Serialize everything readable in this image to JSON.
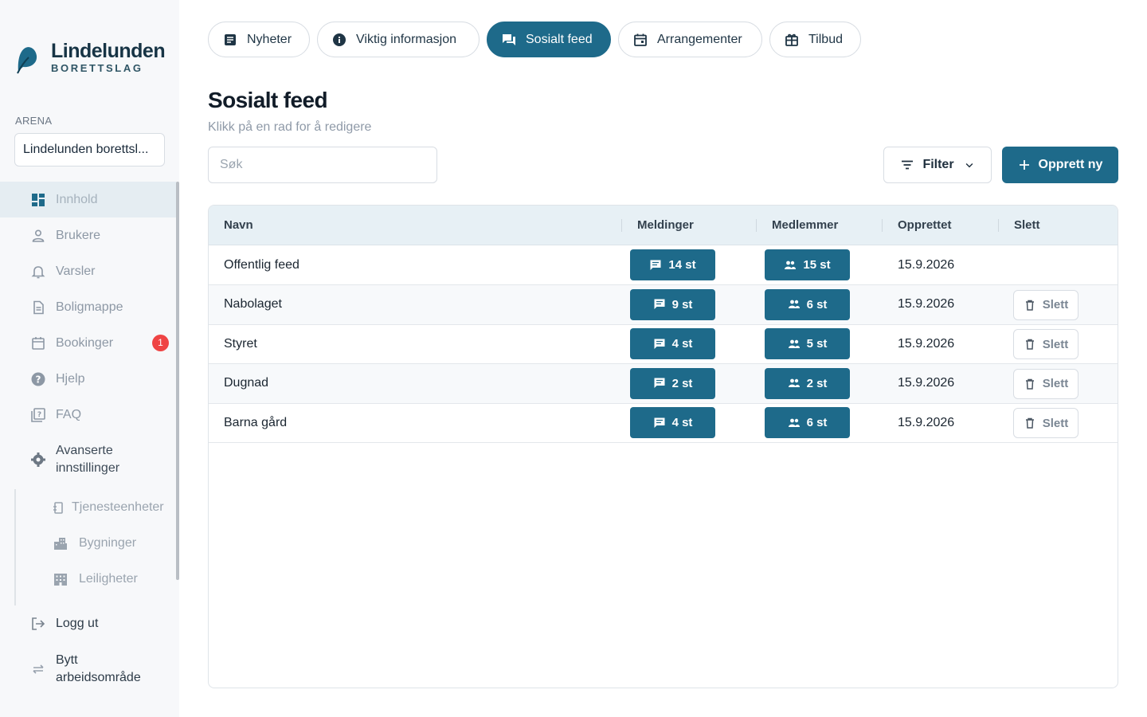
{
  "brand": {
    "name": "Lindelunden",
    "subtitle": "BORETTSLAG",
    "color": "#1e6a8a"
  },
  "sidebar": {
    "arena_label": "ARENA",
    "arena_value": "Lindelunden borettsl...",
    "items": [
      {
        "label": "Innhold",
        "icon": "dashboard-icon",
        "active": true
      },
      {
        "label": "Brukere",
        "icon": "user-icon"
      },
      {
        "label": "Varsler",
        "icon": "bell-icon"
      },
      {
        "label": "Boligmappe",
        "icon": "document-icon"
      },
      {
        "label": "Bookinger",
        "icon": "calendar-icon",
        "badge": "1"
      },
      {
        "label": "Hjelp",
        "icon": "help-icon"
      },
      {
        "label": "FAQ",
        "icon": "faq-icon"
      },
      {
        "label": "Avanserte innstillinger",
        "icon": "gear-icon"
      }
    ],
    "sub_items": [
      {
        "label": "Tjenesteenheter",
        "icon": "device-icon"
      },
      {
        "label": "Bygninger",
        "icon": "building-icon"
      },
      {
        "label": "Leiligheter",
        "icon": "apartment-icon"
      }
    ],
    "logout": "Logg ut",
    "switch_workspace": "Bytt arbeidsområde"
  },
  "tabs": [
    {
      "label": "Nyheter",
      "icon": "article-icon"
    },
    {
      "label": "Viktig informasjon",
      "icon": "info-icon"
    },
    {
      "label": "Sosialt feed",
      "icon": "forum-icon",
      "active": true
    },
    {
      "label": "Arrangementer",
      "icon": "event-icon"
    },
    {
      "label": "Tilbud",
      "icon": "gift-icon"
    }
  ],
  "page": {
    "title": "Sosialt feed",
    "subtitle": "Klikk på en rad for å redigere",
    "search_placeholder": "Søk",
    "filter_label": "Filter",
    "create_label": "Opprett ny"
  },
  "table": {
    "columns": [
      "Navn",
      "Meldinger",
      "Medlemmer",
      "Opprettet",
      "Slett"
    ],
    "delete_label": "Slett",
    "rows": [
      {
        "name": "Offentlig feed",
        "messages": "14 st",
        "members": "15 st",
        "created": "15.9.2026",
        "deletable": false
      },
      {
        "name": "Nabolaget",
        "messages": "9 st",
        "members": "6 st",
        "created": "15.9.2026",
        "deletable": true
      },
      {
        "name": "Styret",
        "messages": "4 st",
        "members": "5 st",
        "created": "15.9.2026",
        "deletable": true
      },
      {
        "name": "Dugnad",
        "messages": "2 st",
        "members": "2 st",
        "created": "15.9.2026",
        "deletable": true
      },
      {
        "name": "Barna gård",
        "messages": "4 st",
        "members": "6 st",
        "created": "15.9.2026",
        "deletable": true
      }
    ]
  }
}
